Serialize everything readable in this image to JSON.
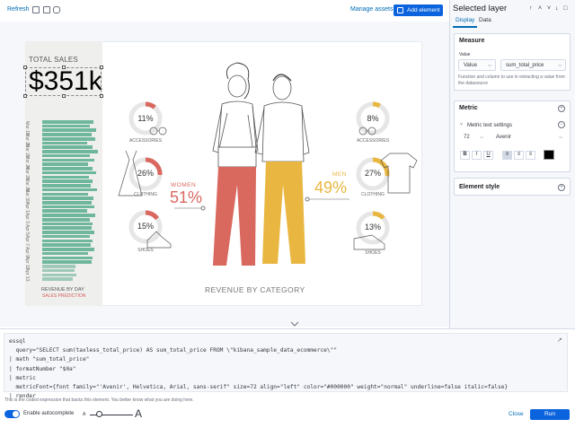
{
  "toolbar": {
    "refresh": "Refresh",
    "manage_assets": "Manage assets",
    "add_element": "Add element"
  },
  "workpad": {
    "total_sales_label": "TOTAL SALES",
    "total_sales_value": "$351k",
    "dates": [
      "Mar 18",
      "Mar 20",
      "Mar 22",
      "Mar 24",
      "Mar 26",
      "Mar 28",
      "Mar 30",
      "Apr 1",
      "Apr 3",
      "Apr 5",
      "Apr 7",
      "Apr 9",
      "Apr 11",
      "Apr 13"
    ],
    "bar_levels": [
      0.92,
      0.85,
      0.97,
      0.88,
      0.95,
      0.8,
      0.9,
      1.0,
      0.86,
      0.93,
      0.82,
      0.91,
      0.96,
      0.84,
      0.9,
      0.87,
      0.99,
      0.83,
      0.92,
      0.88,
      0.94,
      0.81,
      0.95,
      0.86,
      0.9,
      0.89,
      0.93,
      0.85,
      0.91,
      0.87,
      0.94,
      0.82,
      0.9,
      0.88,
      0.6,
      0.58,
      0.62,
      0.55
    ],
    "revenue_by_day": "REVENUE BY DAY",
    "sales_prediction": "SALES PREDICTION",
    "women": {
      "label": "WOMEN",
      "pct": "51%",
      "color": "#d9685f"
    },
    "men": {
      "label": "MEN",
      "pct": "49%",
      "color": "#e9b741"
    },
    "revenue_by_category": "REVENUE BY CATEGORY",
    "women_cats": [
      {
        "value": "11%",
        "label": "ACCESSORIES",
        "level": 0.11
      },
      {
        "value": "26%",
        "label": "CLOTHING",
        "level": 0.26
      },
      {
        "value": "15%",
        "label": "SHOES",
        "level": 0.15
      }
    ],
    "men_cats": [
      {
        "value": "8%",
        "label": "ACCESSORIES",
        "level": 0.08
      },
      {
        "value": "27%",
        "label": "CLOTHING",
        "level": 0.27
      },
      {
        "value": "13%",
        "label": "SHOES",
        "level": 0.13
      }
    ]
  },
  "sidebar": {
    "title": "Selected layer",
    "tabs": {
      "display": "Display",
      "data": "Data"
    },
    "measure": {
      "title": "Measure",
      "value_label": "Value",
      "value_select": "Value",
      "column_select": "sum_total_price",
      "help": "Function and column to use in extracting a value from the datasource"
    },
    "metric": {
      "title": "Metric",
      "text_settings": "Metric text settings",
      "size": "72",
      "font": "Avenir",
      "bold": "B",
      "italic": "I",
      "underline": "U"
    },
    "element_style": "Element style"
  },
  "editor": {
    "lines": [
      "essql",
      "  query=\"SELECT sum(taxless_total_price) AS sum_total_price FROM \\\"kibana_sample_data_ecommerce\\\"\"",
      "| math \"sum_total_price\"",
      "| formatNumber \"$0a\"",
      "| metric",
      "  metricFont={font family=\"'Avenir', Helvetica, Arial, sans-serif\" size=72 align=\"left\" color=\"#000000\" weight=\"normal\" underline=false italic=false}",
      "| render"
    ],
    "help": "This is the coded expression that backs this element. You better know what you are doing here.",
    "autocomplete": "Enable autocomplete",
    "font_small": "A",
    "font_big": "A",
    "close": "Close",
    "run": "Run"
  }
}
